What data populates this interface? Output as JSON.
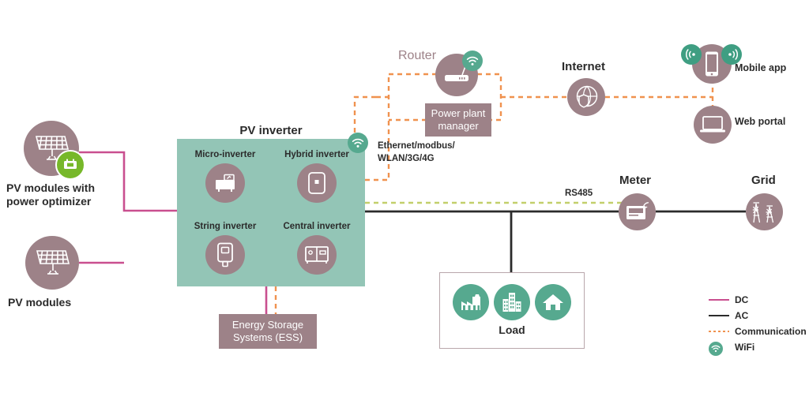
{
  "diagram": {
    "title": "PV system architecture",
    "colors": {
      "dc": "#c94f8f",
      "ac": "#2b2b2b",
      "communication": "#f0924f",
      "rs485": "#c2cf6a",
      "teal_panel": "#93c5b6",
      "mauve": "#9d8288",
      "green_accent": "#56a98f",
      "optimizer_green": "#77b82a"
    }
  },
  "nodes": {
    "pv_optimizer": {
      "label": "PV modules with\npower optimizer",
      "icon": "solar-panel-icon",
      "badge": "power-optimizer-icon"
    },
    "pv_modules": {
      "label": "PV modules",
      "icon": "solar-panel-icon"
    },
    "router": {
      "label": "Router",
      "icon": "router-icon",
      "badge": "wifi-icon"
    },
    "power_plant_manager": {
      "label": "Power plant\nmanager"
    },
    "internet": {
      "label": "Internet",
      "icon": "globe-shield-icon"
    },
    "mobile_app": {
      "label": "Mobile app",
      "icon": "smartphone-icon",
      "badge_left": "signal-icon",
      "badge_right": "signal-icon"
    },
    "web_portal": {
      "label": "Web portal",
      "icon": "laptop-icon"
    },
    "meter": {
      "label": "Meter",
      "icon": "energy-meter-icon"
    },
    "grid": {
      "label": "Grid",
      "icon": "pylon-icon"
    },
    "ess": {
      "label": "Energy Storage\nSystems (ESS)"
    },
    "load": {
      "label": "Load",
      "icons": [
        {
          "name": "factory-icon"
        },
        {
          "name": "office-buildings-icon"
        },
        {
          "name": "house-icon"
        }
      ]
    }
  },
  "inverter_panel": {
    "title": "PV inverter",
    "badge": "wifi-icon",
    "cells": [
      {
        "label": "Micro-inverter",
        "icon": "micro-inverter-icon"
      },
      {
        "label": "Hybrid inverter",
        "icon": "hybrid-inverter-icon"
      },
      {
        "label": "String inverter",
        "icon": "string-inverter-icon"
      },
      {
        "label": "Central inverter",
        "icon": "central-inverter-icon"
      }
    ]
  },
  "annotations": {
    "protocols": "Ethernet/modbus/\nWLAN/3G/4G",
    "rs485": "RS485"
  },
  "legend": {
    "items": [
      {
        "label": "DC",
        "type": "line",
        "color": "#c94f8f"
      },
      {
        "label": "AC",
        "type": "line",
        "color": "#2b2b2b"
      },
      {
        "label": "Communication",
        "type": "dotted",
        "color": "#f0924f"
      },
      {
        "label": "WiFi",
        "type": "wifi-icon",
        "color": "#56a98f"
      }
    ]
  }
}
